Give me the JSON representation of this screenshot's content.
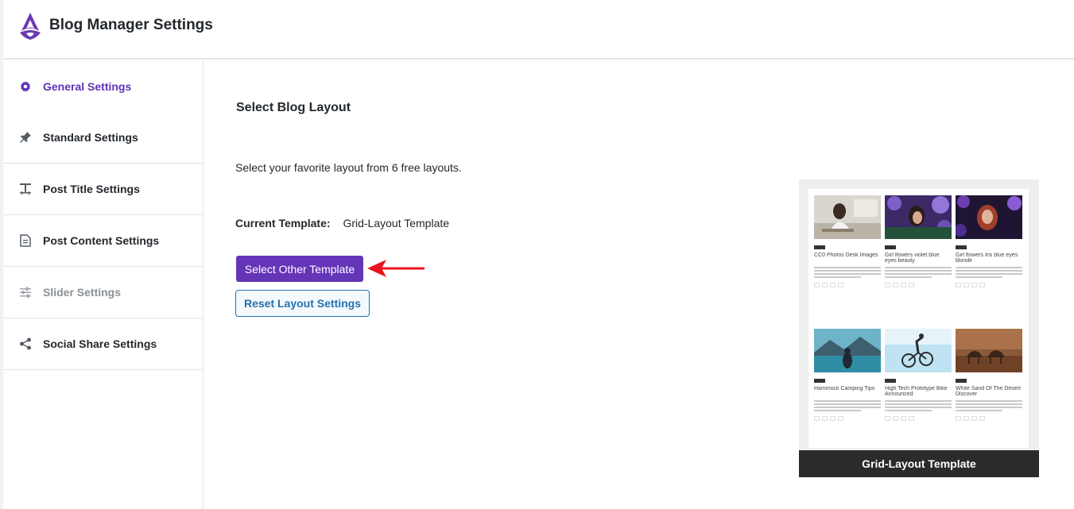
{
  "app": {
    "title": "Blog Manager Settings"
  },
  "sidebar": {
    "items": [
      {
        "label": "General Settings",
        "icon": "gear-icon",
        "state": "active"
      },
      {
        "label": "Standard Settings",
        "icon": "thumbtack-icon",
        "state": "normal"
      },
      {
        "label": "Post Title Settings",
        "icon": "text-height-icon",
        "state": "normal"
      },
      {
        "label": "Post Content Settings",
        "icon": "document-icon",
        "state": "normal"
      },
      {
        "label": "Slider Settings",
        "icon": "sliders-icon",
        "state": "disabled"
      },
      {
        "label": "Social Share Settings",
        "icon": "share-icon",
        "state": "normal"
      }
    ]
  },
  "main": {
    "section_title": "Select Blog Layout",
    "description": "Select your favorite layout from 6 free layouts.",
    "current_template_label": "Current Template:",
    "current_template_value": "Grid-Layout Template",
    "select_button": "Select Other Template",
    "reset_button": "Reset Layout Settings"
  },
  "preview": {
    "caption": "Grid-Layout Template",
    "cards": [
      {
        "title": "CC0 Photos Desk Images",
        "image": "desk-woman-photo"
      },
      {
        "title": "Girl flowers violet blue eyes beauty",
        "image": "violet-flowers-girl-photo"
      },
      {
        "title": "Girl flowers Iris blue eyes blonde",
        "image": "iris-flowers-girl-photo"
      },
      {
        "title": "Hammock Camping Tips",
        "image": "lake-mountains-photo"
      },
      {
        "title": "High Tech Prototype Bike Announced",
        "image": "bmx-jump-photo"
      },
      {
        "title": "White Sand Of The Desert Discover",
        "image": "desert-camels-photo"
      }
    ]
  },
  "colors": {
    "accent": "#6535b8",
    "active_nav": "#6031b7",
    "secondary_border": "#2271b1",
    "caption_bg": "#2b2b2b",
    "arrow": "#e8141e"
  }
}
